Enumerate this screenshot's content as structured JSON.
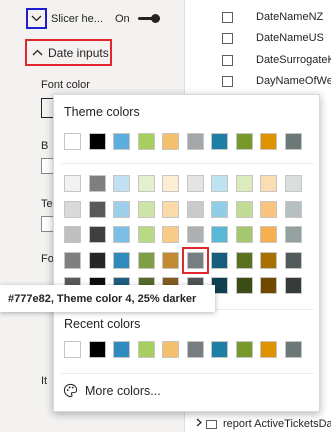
{
  "format_pane": {
    "slicer_header_label": "Slicer he...",
    "slicer_header_toggle": "On",
    "date_inputs_label": "Date inputs",
    "font_color_label": "Font color",
    "partial_labels": [
      "B",
      "Te",
      "Fo",
      "It"
    ]
  },
  "fields": [
    "DateNameNZ",
    "DateNameUS",
    "DateSurrogateK",
    "DayNameOfWe"
  ],
  "bottom_field": "report ActiveTicketsDa",
  "color_picker": {
    "theme_heading": "Theme colors",
    "theme_row": [
      "#ffffff",
      "#000000",
      "#5aaee0",
      "#a7cf60",
      "#f4c06e",
      "#a4a7a9",
      "#1e7fa5",
      "#77982b",
      "#df9300",
      "#6c7878"
    ],
    "shade_rows": [
      [
        "#f2f2f2",
        "#7f7f7f",
        "#bfe1f3",
        "#e2f0cf",
        "#fdedd4",
        "#e3e4e5",
        "#bde3f0",
        "#dcebbc",
        "#fcdcb2",
        "#d9dfdf"
      ],
      [
        "#d9d9d9",
        "#595959",
        "#9dcfeb",
        "#cde4a9",
        "#fad9aa",
        "#c8cacb",
        "#8fcee4",
        "#c2db97",
        "#f9c47f",
        "#b7c0c0"
      ],
      [
        "#bfbfbf",
        "#3f3f3f",
        "#7cbfe6",
        "#b9da85",
        "#f8cc86",
        "#aeb1b3",
        "#5ab8d7",
        "#a5c76f",
        "#f6ae51",
        "#95a1a1"
      ],
      [
        "#7f7f7f",
        "#262626",
        "#2f8abd",
        "#809e43",
        "#c28a32",
        "#777e82",
        "#165f7c",
        "#597220",
        "#a76e00",
        "#515a5a"
      ],
      [
        "#595959",
        "#0d0d0d",
        "#1f5c7e",
        "#566a2d",
        "#815c21",
        "#4f5456",
        "#0f3f52",
        "#3b4c15",
        "#6f4900",
        "#363c3c"
      ]
    ],
    "selected_swatch": {
      "row": 3,
      "col": 5
    },
    "recent_heading": "Recent colors",
    "recent_row": [
      "#ffffff",
      "#000000",
      "#2f8abd",
      "#a7cf60",
      "#f4c06e",
      "#777e82",
      "#1e7fa5",
      "#77982b",
      "#df9300",
      "#6c7878"
    ],
    "more_colors_label": "More colors...",
    "tooltip": "#777e82, Theme color 4, 25% darker"
  }
}
